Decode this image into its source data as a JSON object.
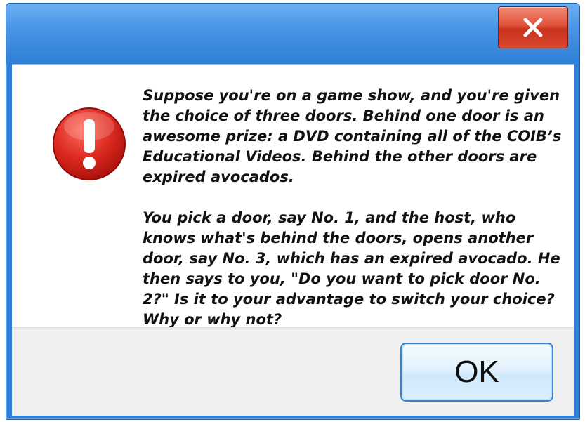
{
  "dialog": {
    "close_icon": "close-icon",
    "alert_icon": "exclamation-alert-icon",
    "message_paragraphs": [
      "Suppose you're on a game show, and you're given the choice of three doors. Behind one door is an awesome prize: a DVD containing all of the COIB’s Educational Videos. Behind the other doors are expired avocados.",
      "You pick a door, say No. 1, and the host, who knows what's behind the doors, opens another door, say No. 3, which has an expired avocado. He then says to you, \"Do you want to pick door No. 2?\" Is it to your advantage to switch your choice? Why or why not?"
    ],
    "ok_label": "OK"
  },
  "colors": {
    "titlebar": "#2f7fd8",
    "close_button": "#d8472f",
    "alert_icon": "#d5201c",
    "ok_border": "#3a83c9"
  }
}
